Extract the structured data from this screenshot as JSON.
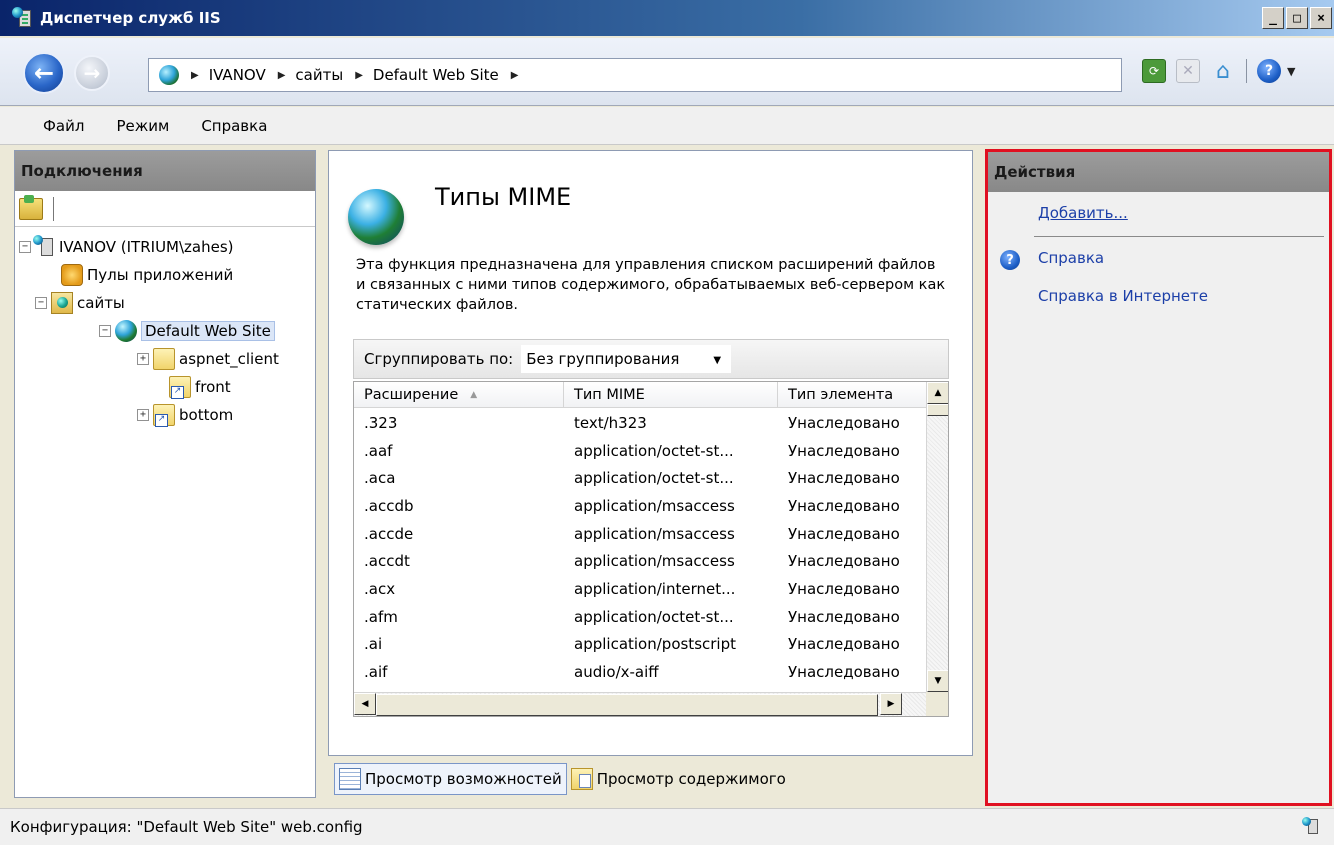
{
  "window": {
    "title": "Диспетчер служб IIS",
    "buttons": [
      "_",
      "□",
      "×"
    ]
  },
  "navigation": {
    "breadcrumbs": [
      "IVANOV",
      "сайты",
      "Default Web Site"
    ],
    "icons": [
      "back-arrow-icon",
      "forward-arrow-icon",
      "globe-icon",
      "refresh-icon",
      "stop-icon",
      "home-icon",
      "help-icon"
    ]
  },
  "menu": {
    "items": [
      "Файл",
      "Режим",
      "Справка"
    ]
  },
  "connections": {
    "header": "Подключения",
    "tree": [
      {
        "label": "IVANOV (ITRIUM\\zahes)",
        "expander": "−",
        "icon": "server-icon"
      },
      {
        "label": "Пулы приложений",
        "expander": "",
        "icon": "app-pool-icon"
      },
      {
        "label": "сайты",
        "expander": "−",
        "icon": "sites-folder-icon"
      },
      {
        "label": "Default Web Site",
        "expander": "−",
        "icon": "globe-icon",
        "selected": true
      },
      {
        "label": "aspnet_client",
        "expander": "+",
        "icon": "folder-icon"
      },
      {
        "label": "front",
        "expander": "",
        "icon": "virtual-dir-icon"
      },
      {
        "label": "bottom",
        "expander": "+",
        "icon": "virtual-dir-icon"
      }
    ]
  },
  "feature": {
    "title": "Типы MIME",
    "description": "Эта функция предназначена для управления списком расширений файлов и связанных с ними типов содержимого, обрабатываемых веб-сервером как статических файлов.",
    "group_label": "Сгруппировать по:",
    "group_value": "Без группирования",
    "columns": [
      "Расширение",
      "Тип MIME",
      "Тип элемента"
    ],
    "rows": [
      [
        ".323",
        "text/h323",
        "Унаследовано"
      ],
      [
        ".aaf",
        "application/octet-st...",
        "Унаследовано"
      ],
      [
        ".aca",
        "application/octet-st...",
        "Унаследовано"
      ],
      [
        ".accdb",
        "application/msaccess",
        "Унаследовано"
      ],
      [
        ".accde",
        "application/msaccess",
        "Унаследовано"
      ],
      [
        ".accdt",
        "application/msaccess",
        "Унаследовано"
      ],
      [
        ".acx",
        "application/internet...",
        "Унаследовано"
      ],
      [
        ".afm",
        "application/octet-st...",
        "Унаследовано"
      ],
      [
        ".ai",
        "application/postscript",
        "Унаследовано"
      ],
      [
        ".aif",
        "audio/x-aiff",
        "Унаследовано"
      ]
    ]
  },
  "view_switch": {
    "features": "Просмотр возможностей",
    "content": "Просмотр содержимого"
  },
  "actions": {
    "header": "Действия",
    "add": "Добавить...",
    "help": "Справка",
    "online_help": "Справка в Интернете"
  },
  "status": {
    "text": "Конфигурация: \"Default Web Site\" web.config"
  },
  "colors": {
    "title_bar": "#0a246a",
    "highlight_border": "#e01020",
    "link": "#1c3fa8"
  }
}
